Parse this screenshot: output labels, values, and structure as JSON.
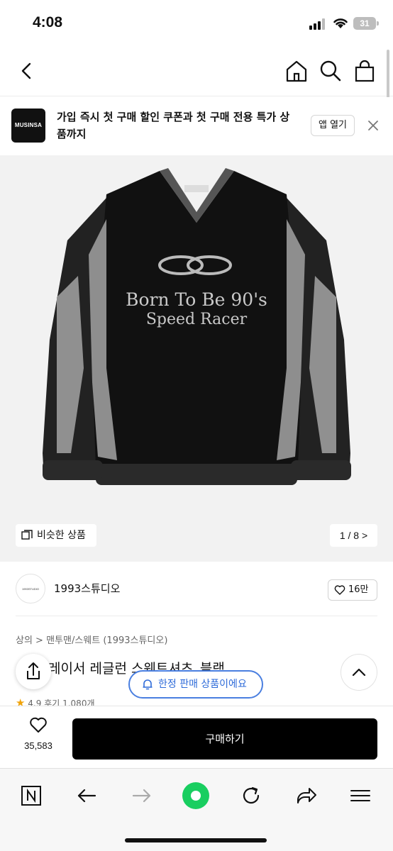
{
  "status_bar": {
    "time": "4:08",
    "battery": "31"
  },
  "nav": {
    "back_icon": "chevron-left-icon",
    "home_icon": "home-icon",
    "search_icon": "search-icon",
    "cart_icon": "shopping-bag-icon"
  },
  "banner": {
    "logo_text": "MUSINSA",
    "text": "가입 즉시 첫 구매 할인 쿠폰과 첫 구매 전용 특가 상품까지",
    "open_app_label": "앱 열기"
  },
  "product_image": {
    "graphic_text_line1": "Born To Be 90's",
    "graphic_text_line2": "Speed Racer",
    "similar_label": "비슷한 상품",
    "page_indicator": "1 / 8 >"
  },
  "brand": {
    "logo_text": "1993STUDIO",
    "name": "1993스튜디오",
    "likes": "16만"
  },
  "product": {
    "breadcrumb": "상의 > 맨투맨/스웨트 (1993스튜디오)",
    "title": "레이서 레글런 스웨트셔츠_블랙",
    "rating": "4.9",
    "reviews": "후기 1,080개",
    "limited_notice": "한정 판매 상품이에요"
  },
  "purchase": {
    "wish_count": "35,583",
    "buy_label": "구매하기"
  },
  "browser_toolbar": {
    "icons": [
      "naver-icon",
      "back-arrow-icon",
      "forward-arrow-icon",
      "green-dot-icon",
      "refresh-icon",
      "share-icon",
      "menu-icon"
    ]
  },
  "colors": {
    "accent_blue": "#2e6bd9",
    "buy_button": "#000000",
    "star": "#f0a30a",
    "naver_green": "#19ce60"
  }
}
